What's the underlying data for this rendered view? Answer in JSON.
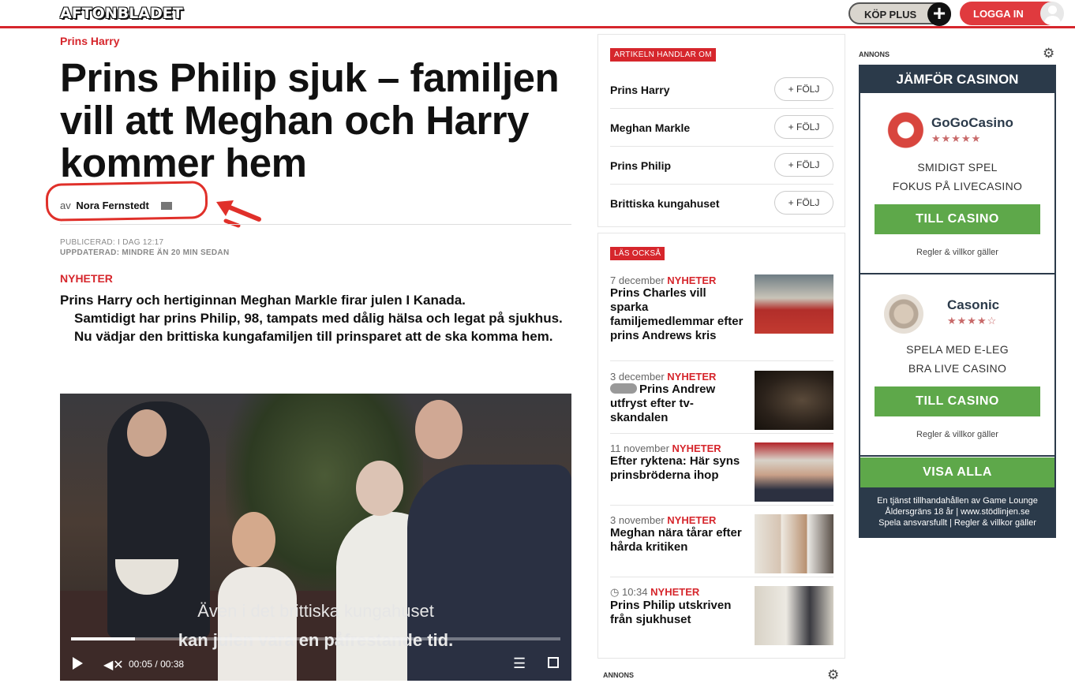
{
  "header": {
    "logo": "AFTONBLADET",
    "plus_label": "KÖP PLUS",
    "plus_symbol": "+",
    "login_label": "LOGGA IN"
  },
  "article": {
    "kicker": "Prins Harry",
    "headline": "Prins Philip sjuk – familjen vill att Meghan och Harry kommer hem",
    "byline_prefix": "av",
    "author": "Nora Fernstedt",
    "published": "PUBLICERAD: I DAG  12:17",
    "updated": "UPPDATERAD: MINDRE ÄN 20 MIN SEDAN",
    "section": "NYHETER",
    "lead": [
      "Prins Harry och hertiginnan Meghan Markle firar julen I Kanada.",
      "Samtidigt har prins Philip, 98, tampats med dålig hälsa och legat på sjukhus.",
      "Nu vädjar den brittiska kungafamiljen till prinsparet att de ska komma hem."
    ]
  },
  "video": {
    "subtitle_line1": "Även i det brittiska kungahuset",
    "subtitle_line2": "kan julen vara en påfrestande tid.",
    "current_time": "00:05",
    "separator": "/",
    "duration": "00:38",
    "progress_fraction": 0.13
  },
  "topics": {
    "tag": "ARTIKELN HANDLAR OM",
    "follow_label": "+ FÖLJ",
    "items": [
      "Prins Harry",
      "Meghan Markle",
      "Prins Philip",
      "Brittiska kungahuset"
    ]
  },
  "read_also": {
    "tag": "LÄS OCKSÅ",
    "items": [
      {
        "date": "7 december",
        "section": "NYHETER",
        "title": "Prins Charles vill sparka familjemedlemmar efter prins Andrews kris"
      },
      {
        "date": "3 december",
        "section": "NYHETER",
        "title": "Prins Andrew utfryst efter tv-skandalen"
      },
      {
        "date": "11 november",
        "section": "NYHETER",
        "title": "Efter ryktena: Här syns prinsbröderna ihop"
      },
      {
        "date": "3 november",
        "section": "NYHETER",
        "title": "Meghan nära tårar efter hårda kritiken"
      },
      {
        "date": "10:34",
        "section": "NYHETER",
        "title": "Prins Philip utskriven från sjukhuset"
      }
    ],
    "bottom_annons": "ANNONS"
  },
  "ad": {
    "annons": "ANNONS",
    "header": "JÄMFÖR CASINON",
    "casinos": [
      {
        "name": "GoGoCasino",
        "stars": "★★★★★",
        "line1": "SMIDIGT SPEL",
        "line2": "FOKUS PÅ LIVECASINO",
        "button": "TILL CASINO",
        "terms": "Regler & villkor gäller"
      },
      {
        "name": "Casonic",
        "stars": "★★★★☆",
        "line1": "SPELA MED E-LEG",
        "line2": "BRA LIVE CASINO",
        "button": "TILL CASINO",
        "terms": "Regler & villkor gäller"
      }
    ],
    "visa_alla": "VISA ALLA",
    "footer1": "En tjänst tillhandahållen av Game Lounge",
    "footer2": "Åldersgräns 18 år | www.stödlinjen.se",
    "footer3": "Spela ansvarsfullt | Regler & villkor gäller"
  },
  "colors": {
    "brand_red": "#d6262c",
    "ad_navy": "#2b3a4a",
    "ad_green": "#5ea84a"
  }
}
